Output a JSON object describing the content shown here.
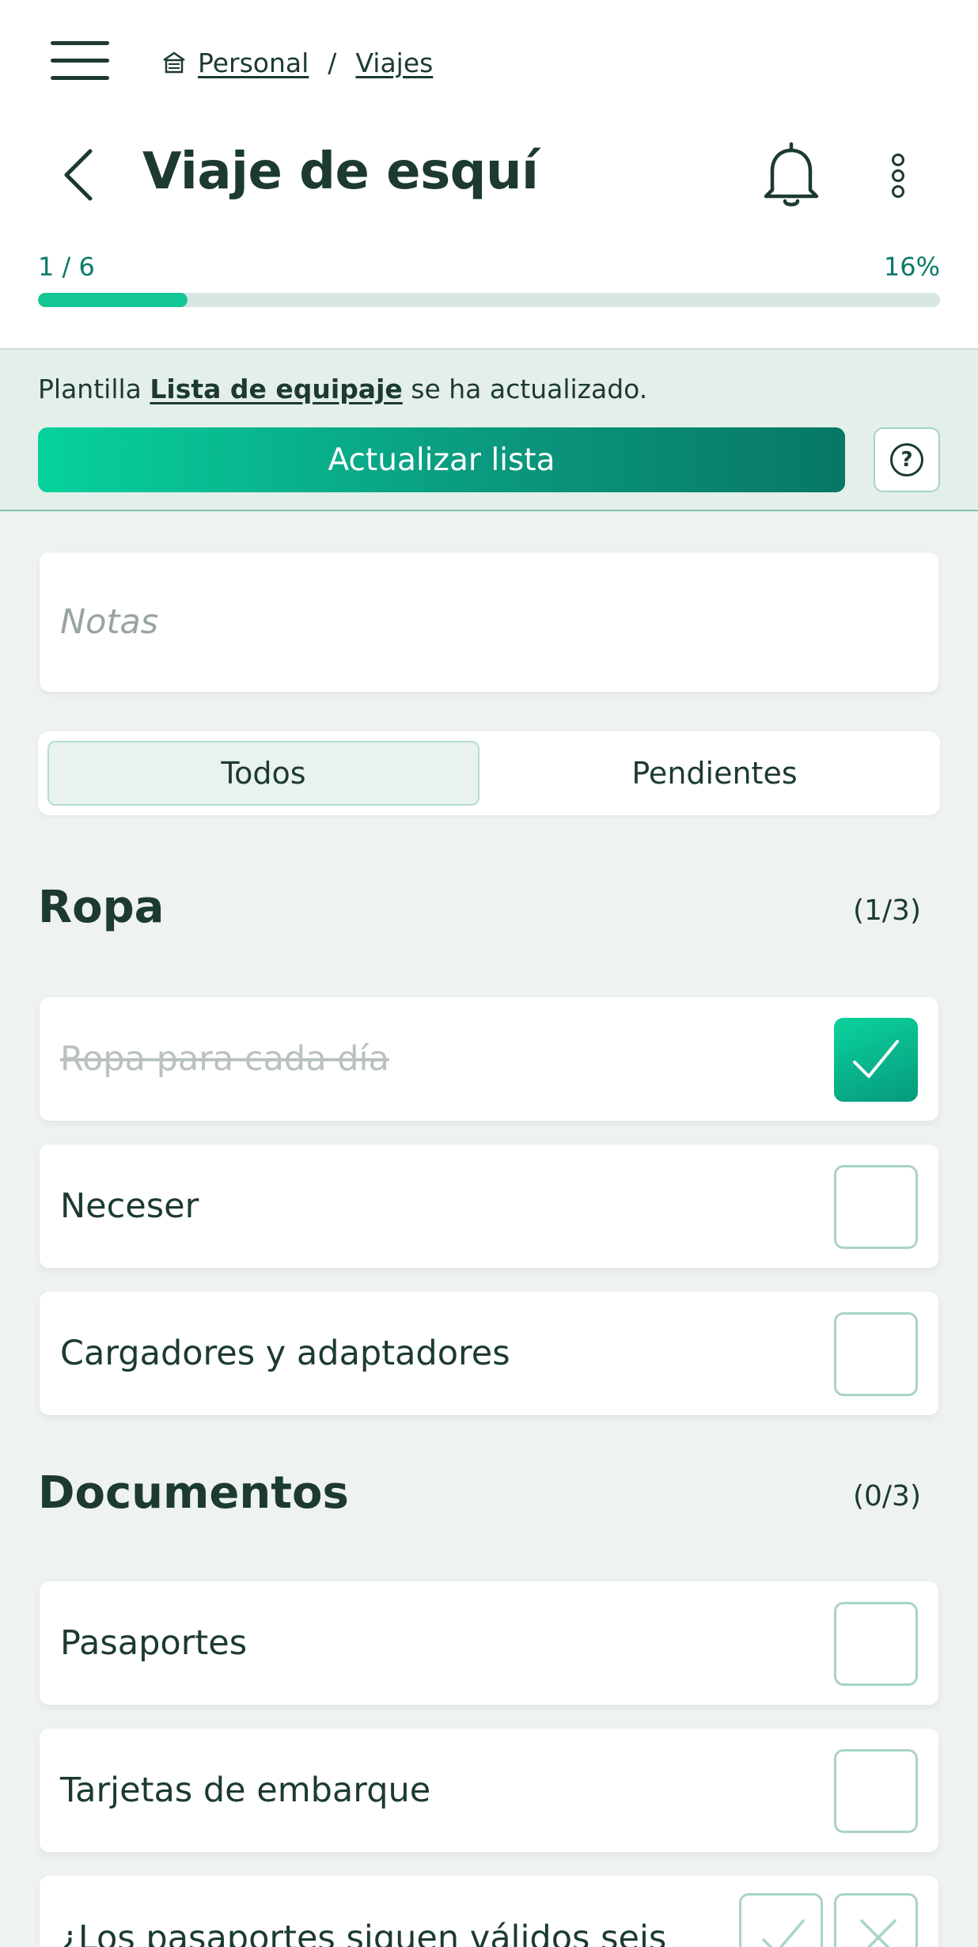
{
  "breadcrumb": {
    "items": [
      "Personal",
      "Viajes"
    ],
    "separator": "/"
  },
  "page": {
    "title": "Viaje de esquí"
  },
  "progress": {
    "label": "1 / 6",
    "percent_label": "16%",
    "fraction": 0.166
  },
  "banner": {
    "prefix": "Plantilla ",
    "template_name": "Lista de equipaje",
    "suffix": " se ha actualizado.",
    "update_button": "Actualizar lista",
    "help_glyph": "?"
  },
  "notes": {
    "placeholder": "Notas",
    "value": ""
  },
  "filters": {
    "tabs": [
      "Todos",
      "Pendientes"
    ],
    "selected": "Todos"
  },
  "sections": [
    {
      "title": "Ropa",
      "count": "(1/3)",
      "items": [
        {
          "label": "Ropa para cada día",
          "checked": true
        },
        {
          "label": "Neceser",
          "checked": false
        },
        {
          "label": "Cargadores y adaptadores",
          "checked": false
        }
      ]
    },
    {
      "title": "Documentos",
      "count": "(0/3)",
      "items": [
        {
          "label": "Pasaportes",
          "checked": false
        },
        {
          "label": "Tarjetas de embarque",
          "checked": false
        },
        {
          "label": "¿Los pasaportes siguen válidos seis",
          "type": "yes-no"
        }
      ]
    }
  ],
  "icons": {
    "menu": "hamburger-menu-icon",
    "home": "home-icon",
    "back": "chevron-left-icon",
    "notifications": "bell-icon",
    "more": "more-vertical-icon",
    "help": "question-circle-icon",
    "check": "checkmark-icon",
    "yes": "checkmark-icon",
    "no": "close-icon"
  },
  "colors": {
    "primary": "#1c3a30",
    "accent": "#14c696",
    "accent_dark": "#077766",
    "progress_track": "#d6e6e0",
    "banner_bg": "#e4efea",
    "page_bg": "#eef2f1"
  }
}
